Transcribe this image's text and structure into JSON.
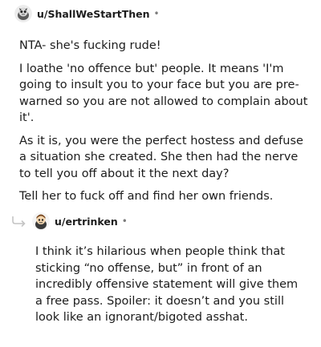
{
  "comments": [
    {
      "username": "u/ShallWeStartThen",
      "separator": "•",
      "avatar_icon": "snoo-avatar-icon",
      "paragraphs": [
        "NTA- she's fucking rude!",
        "I loathe 'no offence but' people. It means 'I'm going to insult you to your face but you are pre-warned so you are not allowed to complain about it'.",
        "As it is, you were the perfect hostess and defuse a situation she created. She then had the nerve to tell you off about it the next day?",
        "Tell her to fuck off and find her own friends."
      ]
    },
    {
      "username": "u/ertrinken",
      "separator": "•",
      "avatar_icon": "snoo-avatar-icon",
      "reply_icon": "reply-arrow-icon",
      "paragraphs": [
        "I think it’s hilarious when people think that sticking “no offense, but” in front of an incredibly offensive statement will give them a free pass. Spoiler: it doesn’t and you still look like an ignorant/bigoted asshat."
      ]
    }
  ]
}
